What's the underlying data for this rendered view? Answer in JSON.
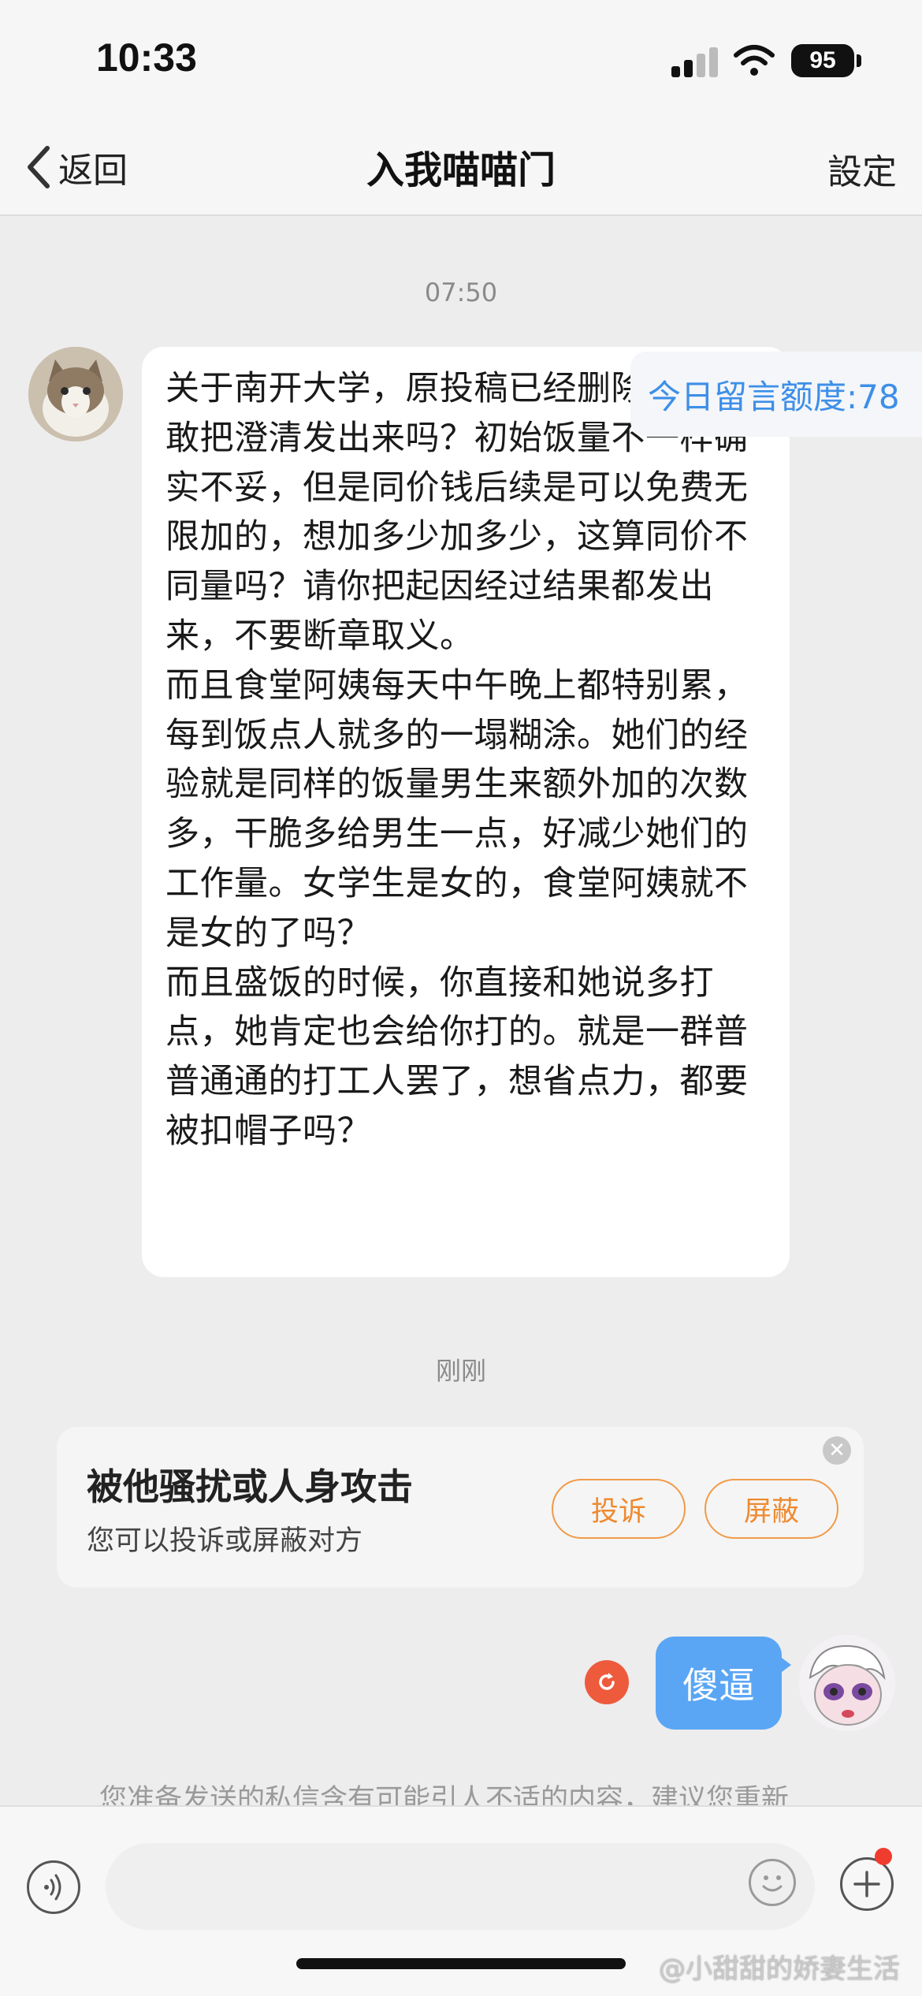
{
  "status_bar": {
    "time": "10:33",
    "battery": "95"
  },
  "nav": {
    "back_label": "返回",
    "title": "入我喵喵门",
    "settings_label": "設定"
  },
  "messages": {
    "timestamp_1": "07:50",
    "incoming_paragraphs": [
      "关于南开大学，原投稿已经删除了，你敢把澄清发出来吗？初始饭量不一样确实不妥，但是同价钱后续是可以免费无限加的，想加多少加多少，这算同价不同量吗？请你把起因经过结果都发出来，不要断章取义。",
      "而且食堂阿姨每天中午晚上都特别累，每到饭点人就多的一塌糊涂。她们的经验就是同样的饭量男生来额外加的次数多，干脆多给男生一点，好减少她们的工作量。女学生是女的，食堂阿姨就不是女的了吗？",
      "而且盛饭的时候，你直接和她说多打点，她肯定也会给你打的。就是一群普普通通的打工人罢了，想省点力，都要被扣帽子吗？"
    ],
    "quota_label": "今日留言额度:78",
    "timestamp_2": "刚刚",
    "outgoing_text": "傻逼",
    "hint": "您准备发送的私信含有可能引人不适的内容，建议您重新"
  },
  "alert": {
    "title": "被他骚扰或人身攻击",
    "subtitle": "您可以投诉或屏蔽对方",
    "report_label": "投诉",
    "block_label": "屏蔽"
  },
  "icons": {
    "back": "chevron-left-icon",
    "voice": "voice-icon",
    "emoji": "emoji-icon",
    "plus": "plus-icon",
    "retry": "retry-icon",
    "close": "close-icon"
  },
  "colors": {
    "outgoing_bubble": "#5aa6f5",
    "alert_accent": "#ee8a30",
    "quota_text": "#3d8fe8",
    "retry": "#ee5a3c"
  },
  "watermark": "@小甜甜的娇妻生活"
}
